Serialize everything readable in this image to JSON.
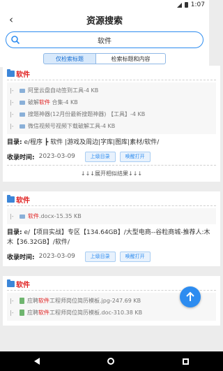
{
  "status": {
    "time": "1:07"
  },
  "header": {
    "title": "资源搜索",
    "back_icon": "back-arrow-icon"
  },
  "search": {
    "value": "软件"
  },
  "tabs": [
    {
      "label": "仅检索标题",
      "active": true
    },
    {
      "label": "检索标题和内容",
      "active": false
    }
  ],
  "results": [
    {
      "title": "软件",
      "files": [
        {
          "prefix": "|-",
          "name_pre": "阿里云盘自动签到工具",
          "name_hl": "",
          "name_post": "-4 KB"
        },
        {
          "prefix": "|-",
          "name_pre": "破解",
          "name_hl": "软件",
          "name_post": " 合集-4 KB"
        },
        {
          "prefix": "|-",
          "name_pre": "搜题神器(12月份最新搜题神器) 【工具】-4 KB",
          "name_hl": "",
          "name_post": ""
        },
        {
          "prefix": "|-",
          "name_pre": "微信视频号视频下载破解工具-4 KB",
          "name_hl": "",
          "name_post": ""
        }
      ],
      "directory_label": "目录:",
      "directory": "e/程序 ┣ 软件 |游戏及周边|字库|图库|素材/软件/",
      "time_label": "收录时间:",
      "time": "2023-03-09",
      "btn_dir": "上级目录",
      "btn_open": "唤醒打开",
      "expand": "↓↓↓展开相似结果↓↓↓"
    },
    {
      "title": "软件",
      "files": [
        {
          "prefix": "|-",
          "name_pre": "",
          "name_hl": "软件",
          "name_post": ".docx-15.35 KB"
        }
      ],
      "directory_label": "目录:",
      "directory": "e/【项目实战】专区【134.64GB】/大型电商--谷粒商城-推荐人:木木【36.32GB】/软件/",
      "time_label": "收录时间:",
      "time": "2023-03-09",
      "btn_dir": "上级目录",
      "btn_open": "唤醒打开"
    },
    {
      "title": "软件",
      "files": [
        {
          "prefix": "|-",
          "name_pre": "应聘",
          "name_hl": "软件",
          "name_post": "工程师岗位简历模板.jpg-247.69 KB"
        },
        {
          "prefix": "|-",
          "name_pre": "应聘",
          "name_hl": "软件",
          "name_post": "工程师岗位简历模板.doc-310.38 KB"
        }
      ]
    }
  ],
  "fab": {
    "icon": "arrow-up-icon"
  }
}
